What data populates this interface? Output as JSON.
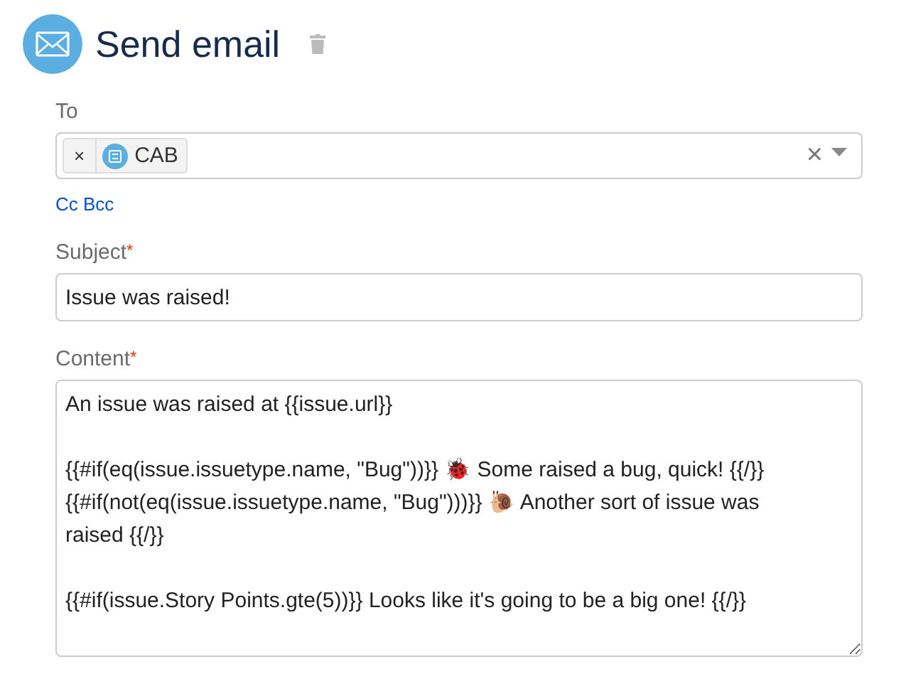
{
  "header": {
    "title": "Send email"
  },
  "to": {
    "label": "To",
    "chips": [
      {
        "remove": "×",
        "label": "CAB"
      }
    ],
    "clear": "×"
  },
  "cc_bcc": "Cc Bcc",
  "subject": {
    "label": "Subject",
    "required_mark": "*",
    "value": "Issue was raised!"
  },
  "content": {
    "label": "Content",
    "required_mark": "*",
    "value": "An issue was raised at {{issue.url}}\n\n{{#if(eq(issue.issuetype.name, \"Bug\"))}} 🐞 Some raised a bug, quick! {{/}}\n{{#if(not(eq(issue.issuetype.name, \"Bug\")))}} 🐌 Another sort of issue was raised {{/}}\n\n{{#if(issue.Story Points.gte(5))}} Looks like it's going to be a big one! {{/}}"
  }
}
